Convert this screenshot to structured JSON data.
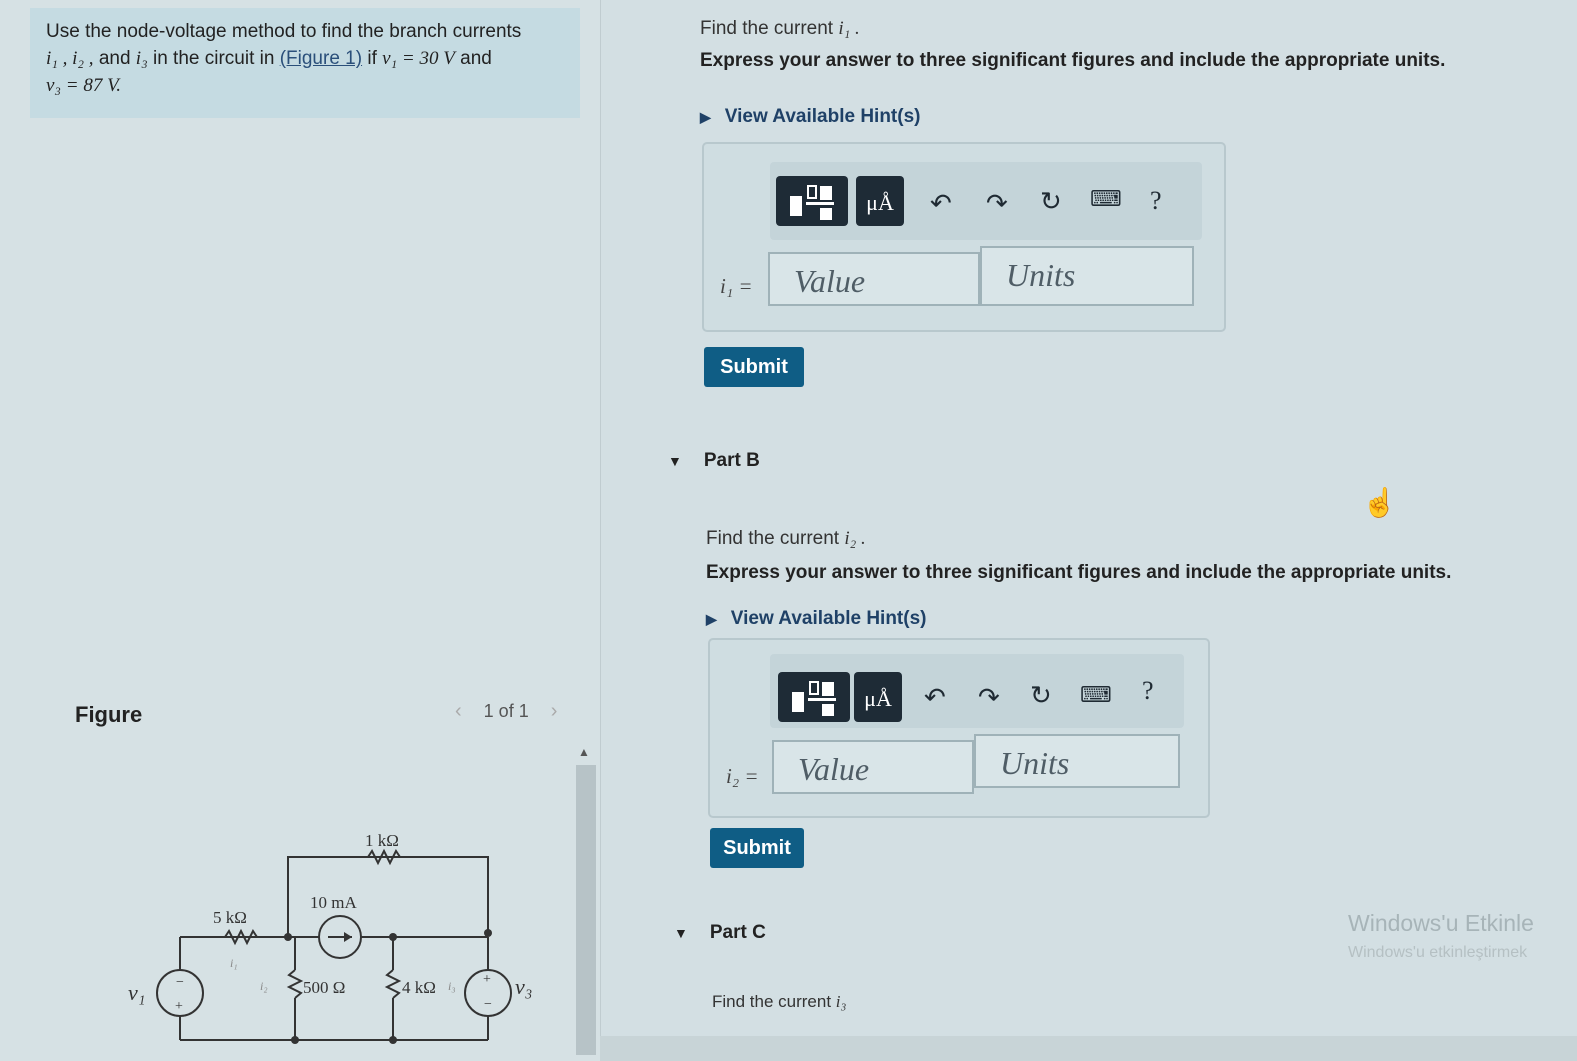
{
  "problem": {
    "line1": "Use the node-voltage method to find the branch currents",
    "line2_vars": "i₁ , i₂ ,",
    "line2_and": "and",
    "line2_i3": "i₃",
    "line2_rest": "in the circuit in",
    "figure_link": "(Figure 1)",
    "line2_if": "if",
    "v1_expr": "v₁ = 30 V",
    "line2_end": "and",
    "v3_expr": "v₃ = 87 V."
  },
  "figure": {
    "label": "Figure",
    "pager_prev": "‹",
    "pager_text": "1 of 1",
    "pager_next": "›",
    "labels": {
      "r_top": "1 kΩ",
      "src_mid": "10 mA",
      "r_left": "5 kΩ",
      "v1": "v₁",
      "r_500": "500 Ω",
      "r_4k": "4 kΩ",
      "v3": "v₃",
      "i1": "i₁",
      "i2": "i₂",
      "i3": "i₃",
      "plus": "+",
      "minus": "−"
    }
  },
  "partA": {
    "question_prefix": "Find the current",
    "question_var": "i₁ .",
    "instruction": "Express your answer to three significant figures and include the appropriate units.",
    "hint": "View Available Hint(s)",
    "toolbar": {
      "mu_label": "μÅ",
      "help": "?"
    },
    "var_label": "i₁ =",
    "value_placeholder": "Value",
    "units_placeholder": "Units",
    "submit": "Submit"
  },
  "partB": {
    "heading": "Part B",
    "question_prefix": "Find the current",
    "question_var": "i₂ .",
    "instruction": "Express your answer to three significant figures and include the appropriate units.",
    "hint": "View Available Hint(s)",
    "toolbar": {
      "mu_label": "μÅ",
      "help": "?"
    },
    "var_label": "i₂ =",
    "value_placeholder": "Value",
    "units_placeholder": "Units",
    "submit": "Submit"
  },
  "partC": {
    "heading": "Part C",
    "question_prefix": "Find the current",
    "question_var": "i₃"
  },
  "watermark": {
    "title": "Windows'u Etkinle",
    "subtitle": "Windows'u etkinleştirmek"
  },
  "icons": [
    "template-icon",
    "undo-icon",
    "redo-icon",
    "reset-icon",
    "keyboard-icon",
    "help-icon",
    "triangle-right-icon",
    "triangle-down-icon",
    "hand-cursor-icon"
  ]
}
